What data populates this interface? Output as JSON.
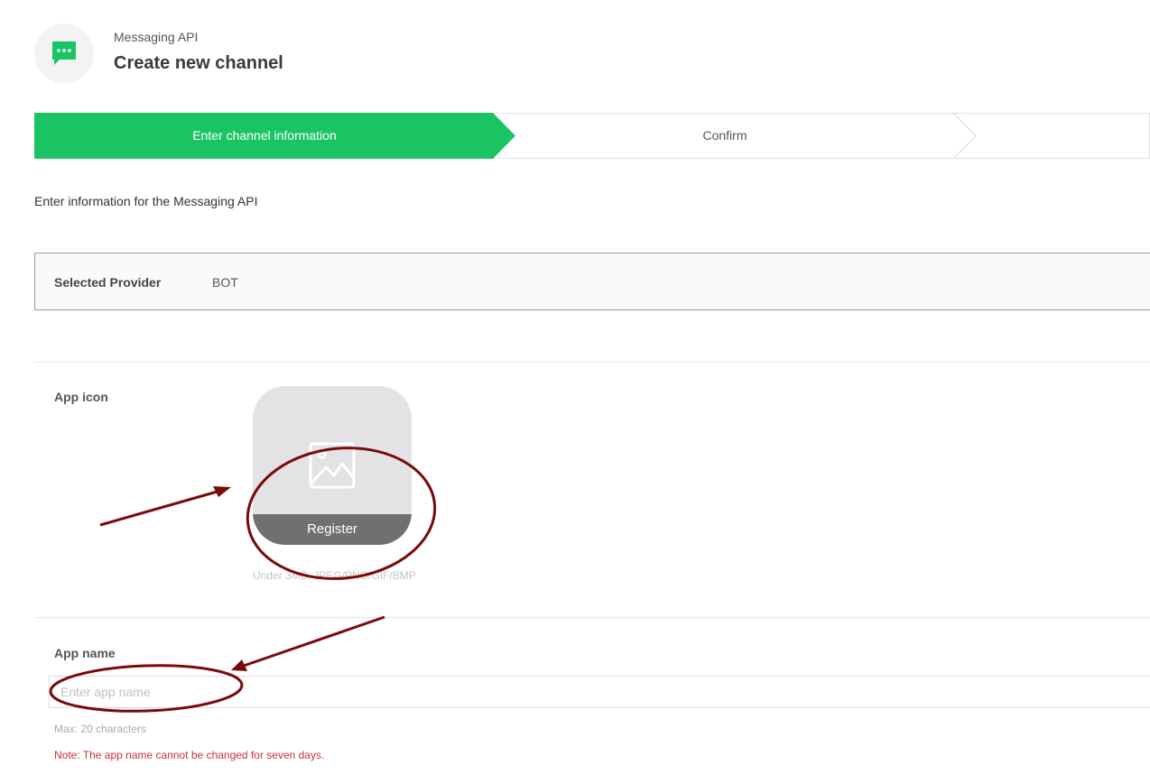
{
  "header": {
    "icon": "chat-bubble-icon",
    "subtitle": "Messaging API",
    "title": "Create new channel"
  },
  "stepper": {
    "active_color": "#1bc462",
    "steps": [
      {
        "label": "Enter channel information",
        "active": true
      },
      {
        "label": "Confirm",
        "active": false
      }
    ]
  },
  "intro_text": "Enter information for the Messaging API",
  "provider": {
    "label": "Selected Provider",
    "value": "BOT"
  },
  "app_icon": {
    "label": "App icon",
    "placeholder_icon": "image-placeholder-icon",
    "register_label": "Register",
    "hint": "Under 3MB, JPEG/PNG/GIF/BMP"
  },
  "app_name": {
    "label": "App name",
    "value": "",
    "placeholder": "Enter app name",
    "max_hint": "Max: 20 characters",
    "note": "Note: The app name cannot be changed for seven days."
  },
  "annotation_color": "#7a0a0a"
}
